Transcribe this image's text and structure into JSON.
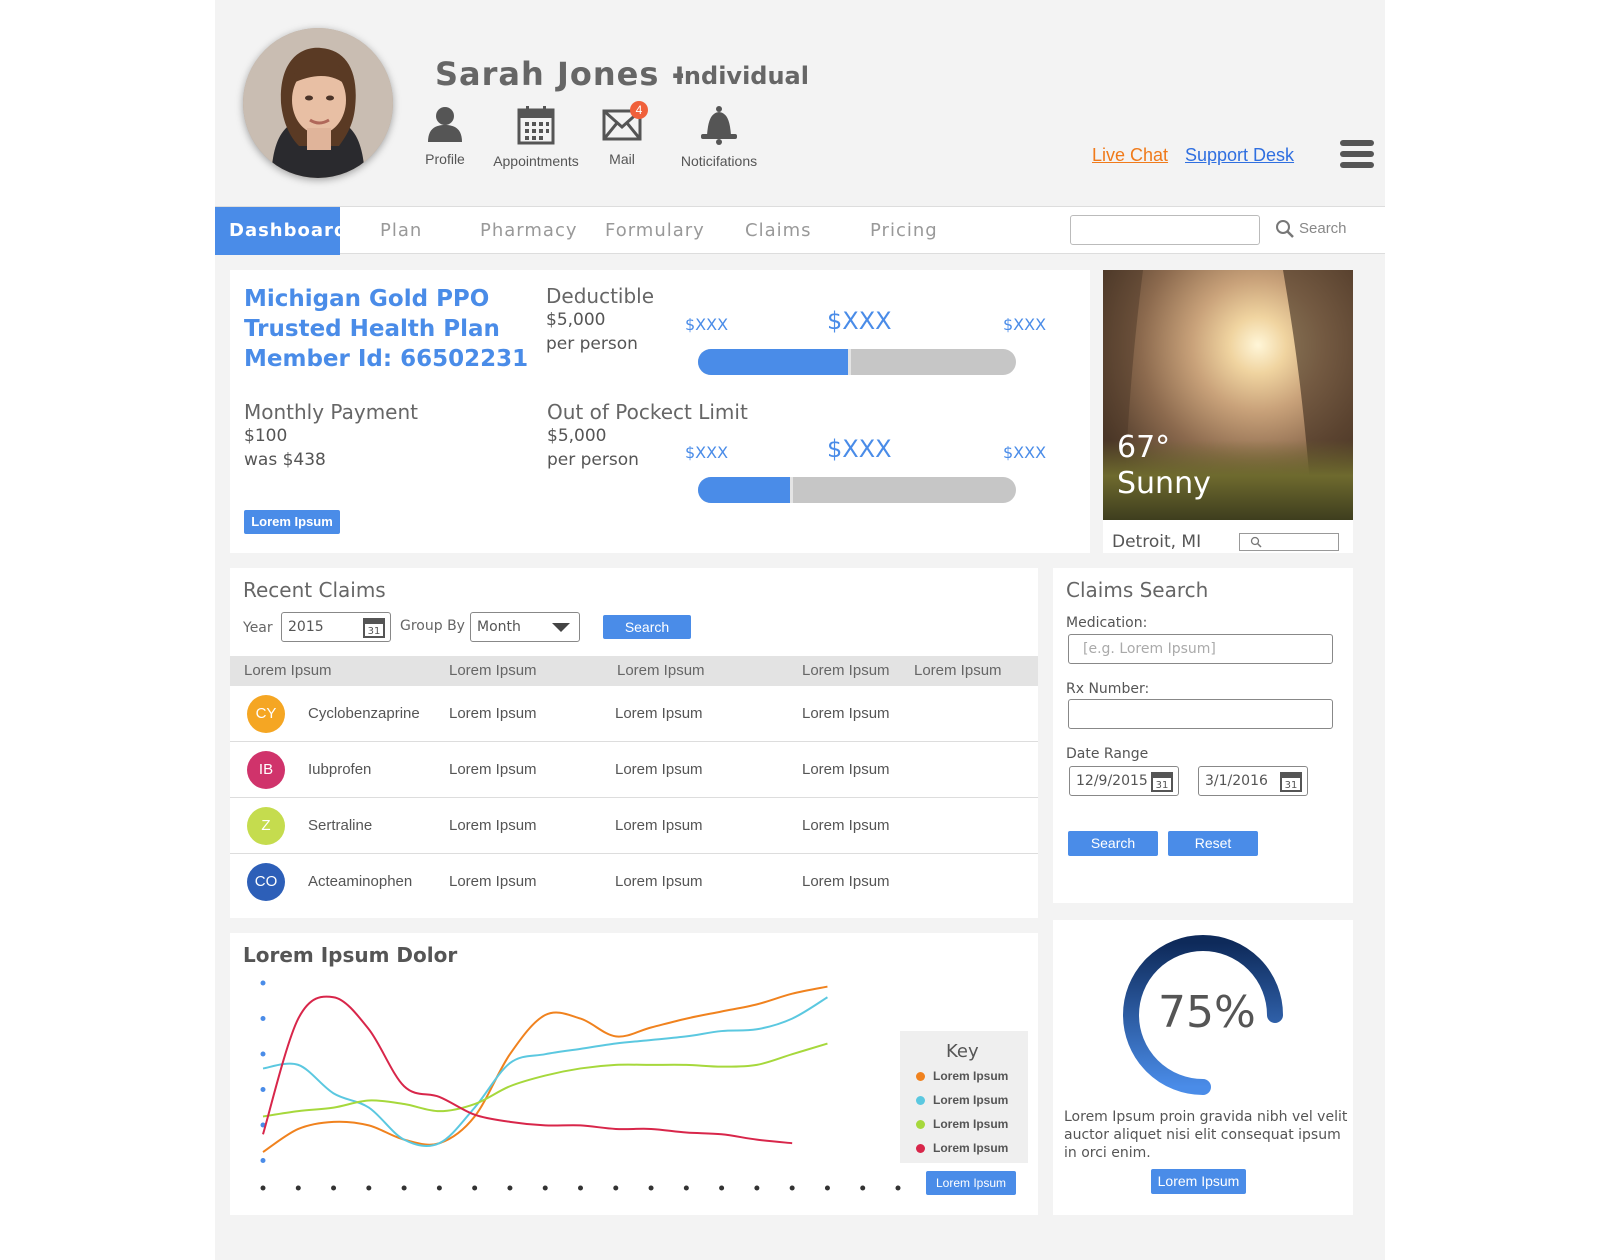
{
  "header": {
    "user_name": "Sarah Jones -",
    "user_type": "Individual",
    "icons": [
      {
        "label": "Profile",
        "icon": "person-icon"
      },
      {
        "label": "Appointments",
        "icon": "calendar-icon"
      },
      {
        "label": "Mail",
        "icon": "mail-icon",
        "badge": "4"
      },
      {
        "label": "Noticifations",
        "icon": "bell-icon"
      }
    ],
    "live_chat": "Live Chat",
    "support_desk": "Support Desk"
  },
  "nav": {
    "tabs": [
      "Dashboard",
      "Plan",
      "Pharmacy",
      "Formulary",
      "Claims",
      "Pricing"
    ],
    "active_tab": "Dashboard",
    "search_label": "Search",
    "search_value": ""
  },
  "plan": {
    "name_line1": "Michigan Gold PPO",
    "name_line2": "Trusted Health Plan",
    "member_id": "Member Id: 66502231",
    "monthly_payment_title": "Monthly Payment",
    "monthly_payment_value": "$100",
    "monthly_payment_was": "was $438",
    "button": "Lorem Ipsum",
    "deductible": {
      "title": "Deductible",
      "amount": "$5,000",
      "unit": "per person",
      "min_label": "$XXX",
      "current_label": "$XXX",
      "max_label": "$XXX",
      "progress": 0.48
    },
    "out_of_pocket": {
      "title": "Out of Pockect Limit",
      "amount": "$5,000",
      "unit": "per person",
      "min_label": "$XXX",
      "current_label": "$XXX",
      "max_label": "$XXX",
      "progress": 0.3
    }
  },
  "weather": {
    "temperature": "67°",
    "condition": "Sunny",
    "city": "Detroit, MI",
    "search_value": ""
  },
  "recent_claims": {
    "title": "Recent Claims",
    "year_label": "Year",
    "year_value": "2015",
    "group_by_label": "Group By",
    "group_by_value": "Month",
    "search_button": "Search",
    "columns": [
      "Lorem Ipsum",
      "Lorem Ipsum",
      "Lorem Ipsum",
      "Lorem Ipsum",
      "Lorem Ipsum"
    ],
    "rows": [
      {
        "initials": "CY",
        "color": "#f5a623",
        "name": "Cyclobenzaprine",
        "c1": "Lorem Ipsum",
        "c2": "Lorem Ipsum",
        "c3": "Lorem Ipsum"
      },
      {
        "initials": "IB",
        "color": "#d0336b",
        "name": "Iubprofen",
        "c1": "Lorem Ipsum",
        "c2": "Lorem Ipsum",
        "c3": "Lorem Ipsum"
      },
      {
        "initials": "Z",
        "color": "#c5dc4e",
        "name": "Sertraline",
        "c1": "Lorem Ipsum",
        "c2": "Lorem Ipsum",
        "c3": "Lorem Ipsum"
      },
      {
        "initials": "CO",
        "color": "#2d5fb8",
        "name": "Acteaminophen",
        "c1": "Lorem Ipsum",
        "c2": "Lorem Ipsum",
        "c3": "Lorem Ipsum"
      }
    ]
  },
  "claims_search": {
    "title": "Claims Search",
    "medication_label": "Medication:",
    "medication_placeholder": "[e.g. Lorem Ipsum]",
    "rx_label": "Rx Number:",
    "rx_value": "",
    "date_range_label": "Date Range",
    "date_from": "12/9/2015",
    "date_to": "3/1/2016",
    "search_button": "Search",
    "reset_button": "Reset"
  },
  "chart": {
    "title": "Lorem Ipsum Dolor",
    "key_title": "Key",
    "button": "Lorem Ipsum"
  },
  "chart_data": {
    "type": "line",
    "title": "Lorem Ipsum Dolor",
    "xlabel": "",
    "ylabel": "",
    "x": [
      0,
      1,
      2,
      3,
      4,
      5,
      6,
      7,
      8,
      9,
      10,
      11,
      12,
      13,
      14,
      15,
      16,
      17,
      18
    ],
    "ylim": [
      0,
      100
    ],
    "grid": false,
    "legend": "right",
    "series": [
      {
        "name": "Lorem Ipsum",
        "color": "#f0821e",
        "values": [
          5,
          18,
          22,
          20,
          12,
          10,
          25,
          60,
          82,
          80,
          70,
          75,
          80,
          84,
          88,
          94,
          98,
          null,
          null
        ]
      },
      {
        "name": "Lorem Ipsum",
        "color": "#5bc8e0",
        "values": [
          52,
          54,
          38,
          30,
          12,
          10,
          30,
          55,
          60,
          63,
          66,
          68,
          70,
          73,
          74,
          80,
          92,
          null,
          null
        ]
      },
      {
        "name": "Lorem Ipsum",
        "color": "#a6d83c",
        "values": [
          25,
          28,
          30,
          34,
          32,
          28,
          32,
          42,
          48,
          52,
          54,
          54,
          54,
          53,
          54,
          60,
          66,
          null,
          null
        ]
      },
      {
        "name": "Lorem Ipsum",
        "color": "#d8264a",
        "values": [
          15,
          80,
          92,
          74,
          42,
          36,
          26,
          22,
          20,
          20,
          18,
          18,
          16,
          15,
          12,
          10,
          null,
          null,
          null
        ]
      }
    ]
  },
  "progress_widget": {
    "percent_label": "75%",
    "value": 0.75,
    "text": "Lorem Ipsum proin gravida nibh vel velit auctor aliquet nisi elit consequat ipsum in orci enim.",
    "button": "Lorem Ipsum"
  },
  "colors": {
    "accent": "#4a8ce8",
    "live_chat": "#f07a1a",
    "support_desk": "#2f6fe0"
  }
}
